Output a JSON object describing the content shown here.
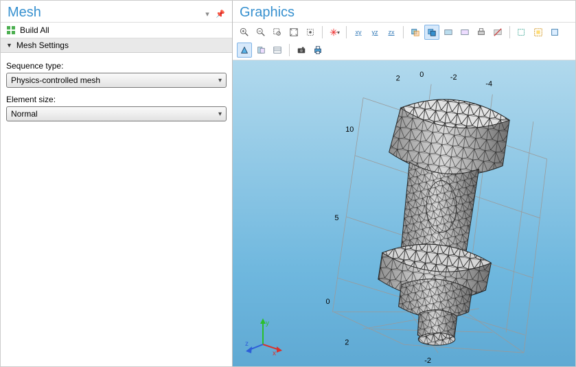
{
  "left": {
    "title": "Mesh",
    "build_all": "Build All",
    "section_title": "Mesh Settings",
    "seq_label": "Sequence type:",
    "seq_value": "Physics-controlled mesh",
    "size_label": "Element size:",
    "size_value": "Normal"
  },
  "right": {
    "title": "Graphics",
    "view_buttons": {
      "xy": "xy",
      "yz": "yz",
      "zx": "zx"
    }
  },
  "axes": {
    "y_ticks": [
      "10",
      "5",
      "0"
    ],
    "top_ticks": [
      "2",
      "0",
      "-2",
      "-4"
    ],
    "bot_ticks_a": [
      "2"
    ],
    "bot_ticks_b": [
      "-2"
    ]
  },
  "triad": {
    "x": "x",
    "y": "y",
    "z": "z"
  }
}
